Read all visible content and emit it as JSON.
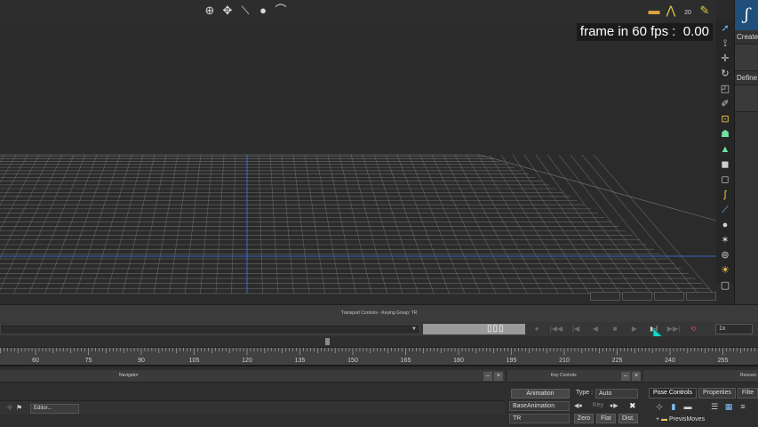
{
  "viewport": {
    "fps_label": "frame in 60 fps :  0.00",
    "colors": {
      "grid": "#8a8a8a",
      "axis_blue": "#3b6fd8",
      "background": "#2b2b2b"
    }
  },
  "top_toolbar": {
    "center_icons": [
      "orbit-icon",
      "pan-icon",
      "zoom-line-icon",
      "zoom-icon",
      "undo-arc-icon"
    ],
    "right_icons": [
      "timeline-icon",
      "motion-path-icon",
      "zoom-20-icon",
      "brush-icon"
    ],
    "zoom_value": "20"
  },
  "right_tools": [
    "select-arrow-icon",
    "bone-icon",
    "move-icon",
    "rotate-icon",
    "scale-icon",
    "pen-icon",
    "box-transform-icon",
    "skin-icon",
    "weight-icon",
    "cube-icon",
    "cube-alt-icon",
    "curve-icon",
    "needle-icon",
    "sphere-icon",
    "light-icon",
    "camera-icon",
    "sun-icon",
    "frame-icon"
  ],
  "side_panel": {
    "create_label": "Create",
    "define_label": "Define"
  },
  "transport": {
    "title": "Transport Controls  -  Keying Group: TR",
    "speed": "1x"
  },
  "ruler": {
    "labels": [
      "60",
      "75",
      "90",
      "105",
      "120",
      "135",
      "150",
      "165",
      "180",
      "195",
      "210",
      "225",
      "240",
      "255"
    ]
  },
  "navigator": {
    "title": "Navigator",
    "editor_tab": "Editor..."
  },
  "key_controls": {
    "title": "Key Controls",
    "animation_btn": "Animation",
    "type_label": "Type :",
    "type_value": "Auto",
    "base_animation": "BaseAnimation",
    "key_label": "Key",
    "group": "TR",
    "zero_btn": "Zero",
    "flat_btn": "Flat",
    "dist_btn": "Dist."
  },
  "resources": {
    "title": "Resourc",
    "tabs": [
      "Pose Controls",
      "Properties",
      "Filte"
    ],
    "tree_item": "PrevisMoves"
  }
}
